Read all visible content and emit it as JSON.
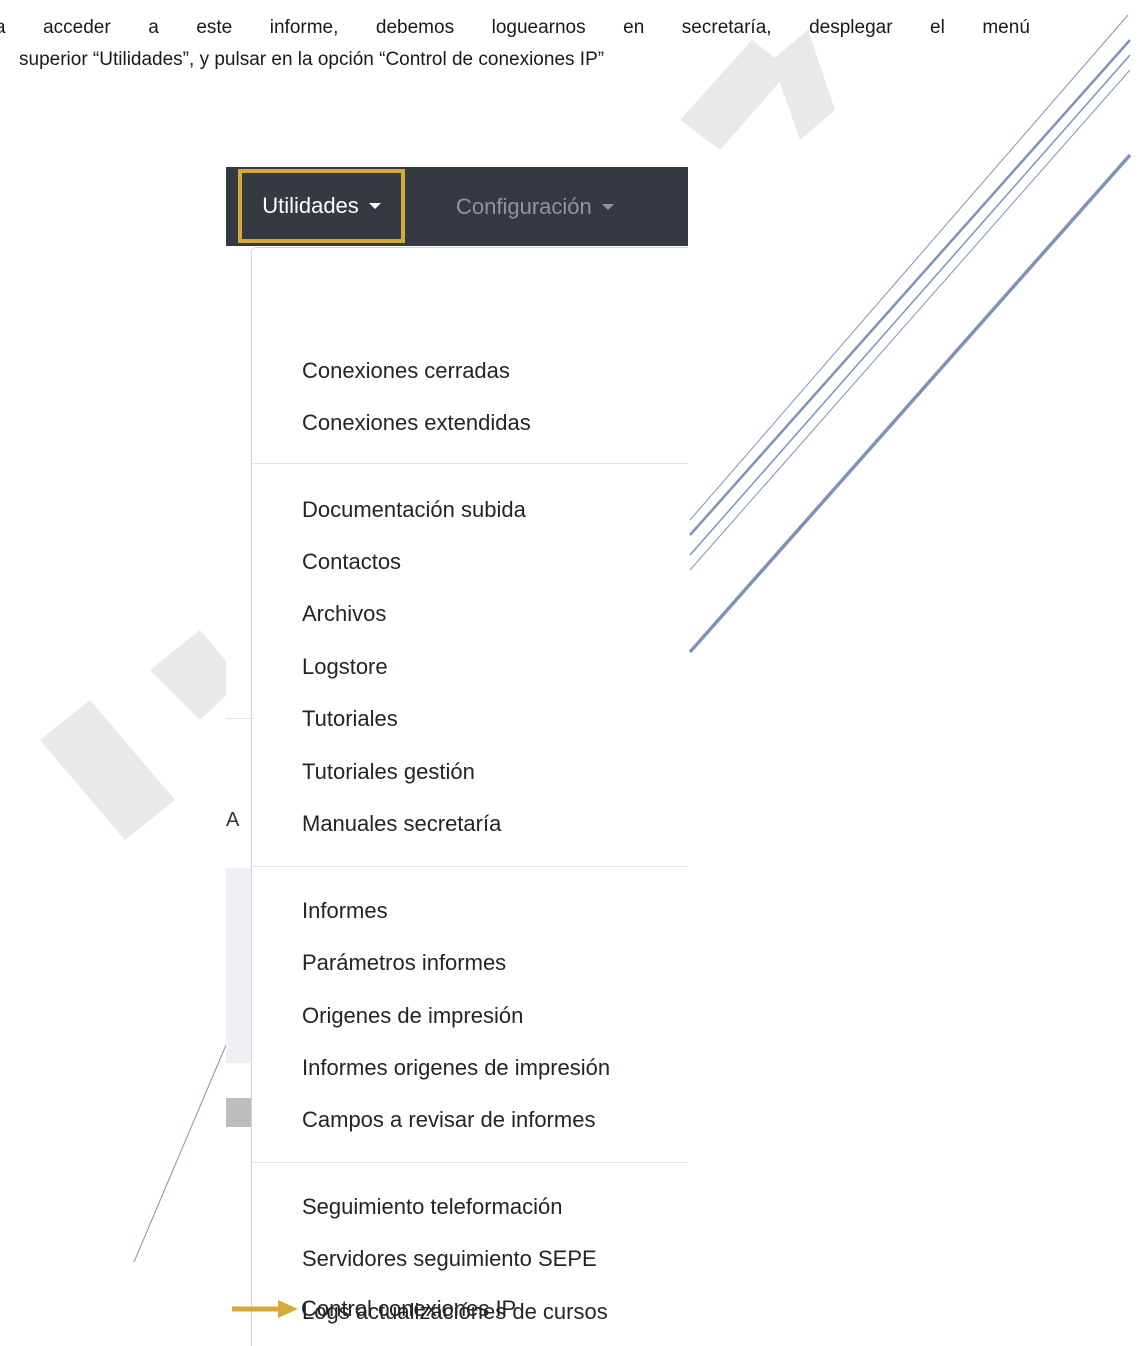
{
  "paragraph": {
    "line1_words": [
      "a",
      "acceder",
      "a",
      "este",
      "informe,",
      "debemos",
      "loguearnos",
      "en",
      "secretaría,",
      "desplegar",
      "el",
      "menú"
    ],
    "line2": "superior “Utilidades”, y pulsar en la opción “Control de conexiones IP”"
  },
  "navbar": {
    "items": [
      "Utilidades",
      "Configuración"
    ],
    "highlight_color": "#d4ab3a",
    "background_color": "#343a40"
  },
  "background": {
    "partial_letter": "A"
  },
  "dropdown": {
    "groups": [
      [
        "Conexiones cerradas",
        "Conexiones extendidas"
      ],
      [
        "Documentación subida",
        "Contactos",
        "Archivos",
        "Logstore",
        "Tutoriales",
        "Tutoriales gestión",
        "Manuales secretaría"
      ],
      [
        "Informes",
        "Parámetros informes",
        "Origenes de impresión",
        "Informes origenes de impresión",
        "Campos a revisar de informes"
      ],
      [
        "Seguimiento teleformación",
        "Servidores seguimiento SEPE",
        "Logs actualizaciónes de cursos"
      ],
      [
        "Control conexiones IP"
      ]
    ]
  },
  "annotation": {
    "arrow_icon": "right-arrow-icon",
    "arrow_color": "#d4ab3a"
  },
  "colors": {
    "decor_line": "#7f93b8",
    "watermark": "#e9e9e9"
  }
}
